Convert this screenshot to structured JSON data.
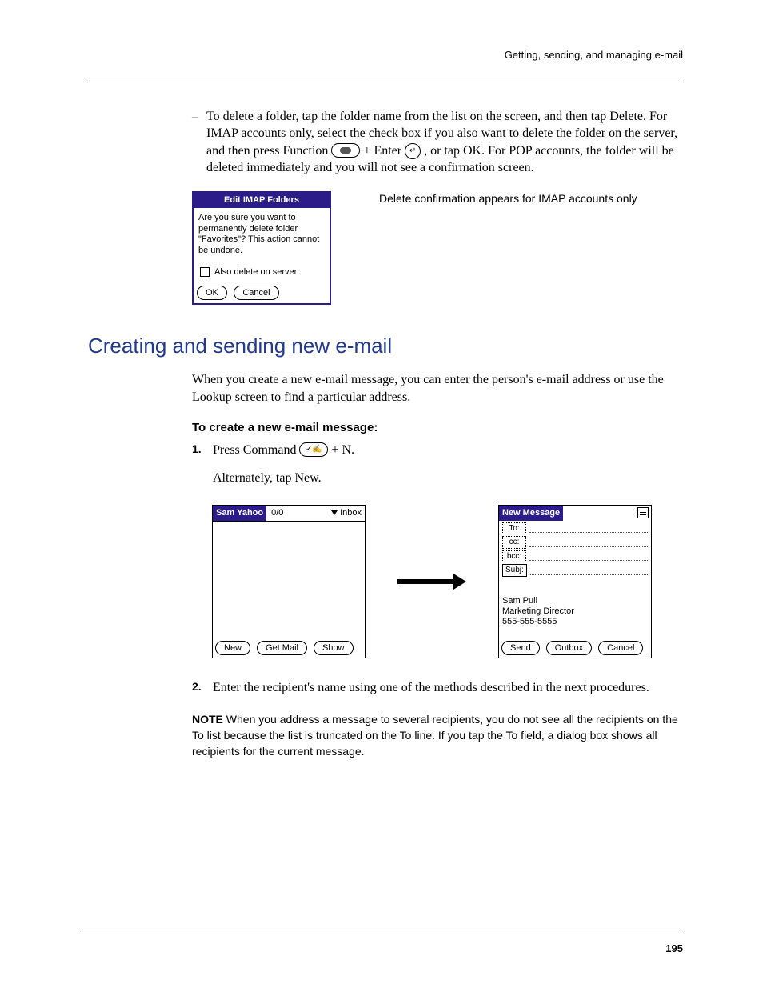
{
  "runningHead": "Getting, sending, and managing e-mail",
  "bullet": {
    "dash": "–",
    "textA": "To delete a folder, tap the folder name from the list on the screen, and then tap Delete. For IMAP accounts only, select the check box if you also want to delete the folder on the server, and then press Function ",
    "textB": " + Enter ",
    "textC": ", or tap OK. For POP accounts, the folder will be deleted immediately and you will not see a confirmation screen."
  },
  "dialog1": {
    "title": "Edit IMAP Folders",
    "body": "Are you sure you want to permanently delete folder \"Favorites\"? This action cannot be undone.",
    "checkbox": "Also delete on server",
    "ok": "OK",
    "cancel": "Cancel"
  },
  "dialog1Caption": "Delete confirmation appears for IMAP accounts only",
  "sectionTitle": "Creating and sending new e-mail",
  "sectionIntro": "When you create a new e-mail message, you can enter the person's e-mail address or use the Lookup screen to find a particular address.",
  "subhead": "To create a new e-mail message:",
  "step1": {
    "num": "1.",
    "textA": "Press Command ",
    "textB": " + N.",
    "after": "Alternately, tap New."
  },
  "inboxScreen": {
    "title": "Sam Yahoo",
    "count": "0/0",
    "menu": "Inbox",
    "btnNew": "New",
    "btnGetMail": "Get Mail",
    "btnShow": "Show"
  },
  "composeScreen": {
    "title": "New Message",
    "fields": {
      "to": "To:",
      "cc": "cc:",
      "bcc": "bcc:",
      "subj": "Subj:"
    },
    "sigName": "Sam Pull",
    "sigTitle": "Marketing Director",
    "sigPhone": "555-555-5555",
    "btnSend": "Send",
    "btnOutbox": "Outbox",
    "btnCancel": "Cancel"
  },
  "step2": {
    "num": "2.",
    "text": "Enter the recipient's name using one of the methods described in the next procedures."
  },
  "note": {
    "label": "NOTE",
    "text": "   When you address a message to several recipients, you do not see all the recipients on the To list because the list is truncated on the To line. If you tap the To field, a dialog box shows all recipients for the current message."
  },
  "pageNumber": "195",
  "enterGlyph": "↵",
  "cmdGlyph": "✓✍"
}
